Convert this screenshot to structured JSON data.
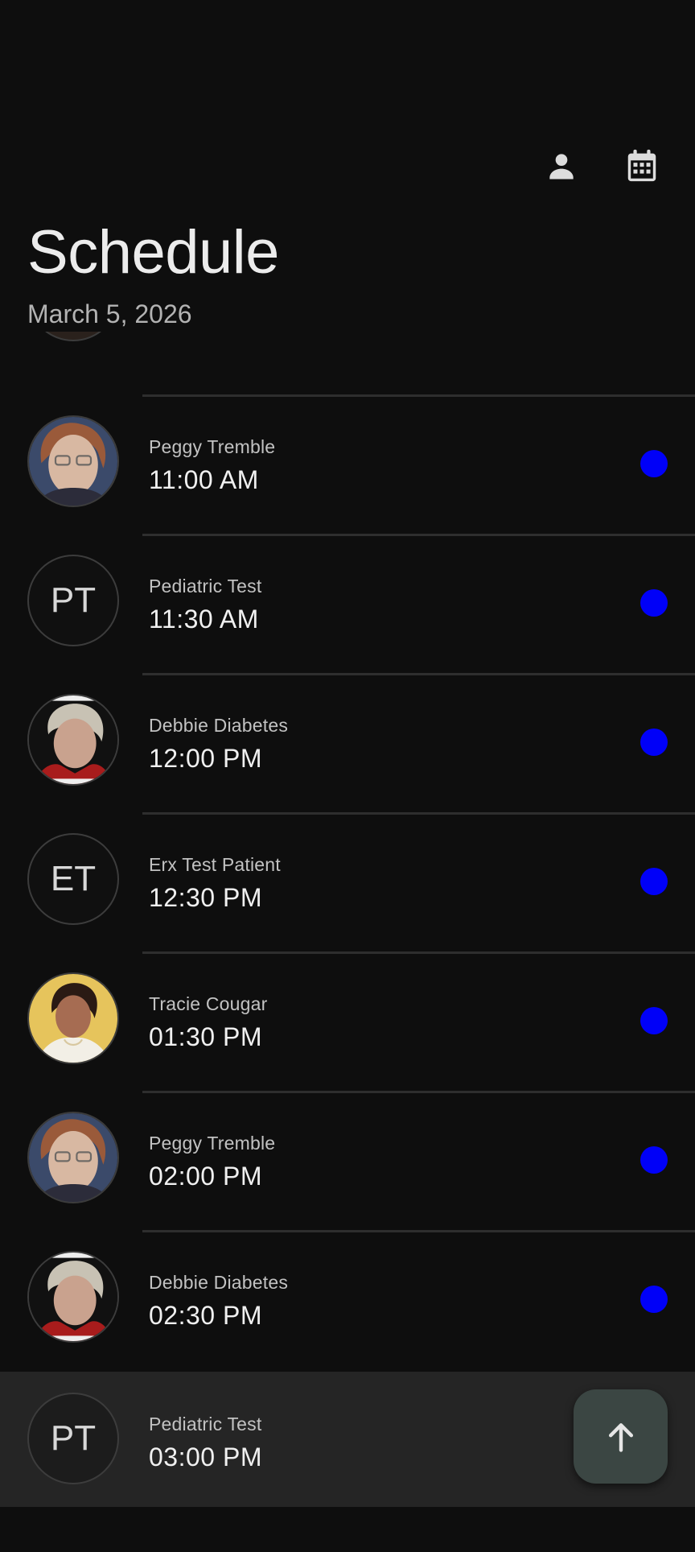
{
  "header": {
    "title": "Schedule",
    "date": "March 5, 2026",
    "actions": [
      {
        "icon": "person-icon"
      },
      {
        "icon": "calendar-icon"
      }
    ]
  },
  "colors": {
    "background": "#0e0e0e",
    "status_dot": "#0000f8",
    "fab": "#3b4643",
    "selected_row": "#252525"
  },
  "appointments": [
    {
      "name": "Peggy Tremble",
      "time": "11:00 AM",
      "avatar": "photo",
      "status": "blue-dot"
    },
    {
      "name": "Pediatric Test",
      "time": "11:30 AM",
      "avatar": "initials",
      "initials": "PT",
      "status": "blue-dot"
    },
    {
      "name": "Debbie Diabetes",
      "time": "12:00 PM",
      "avatar": "photo",
      "status": "blue-dot"
    },
    {
      "name": "Erx Test Patient",
      "time": "12:30 PM",
      "avatar": "initials",
      "initials": "ET",
      "status": "blue-dot"
    },
    {
      "name": "Tracie Cougar",
      "time": "01:30 PM",
      "avatar": "photo",
      "status": "blue-dot"
    },
    {
      "name": "Peggy Tremble",
      "time": "02:00 PM",
      "avatar": "photo",
      "status": "blue-dot"
    },
    {
      "name": "Debbie Diabetes",
      "time": "02:30 PM",
      "avatar": "photo",
      "status": "blue-dot"
    },
    {
      "name": "Pediatric Test",
      "time": "03:00 PM",
      "avatar": "initials",
      "initials": "PT",
      "status": "none"
    }
  ],
  "fab": {
    "icon": "arrow-up-icon"
  }
}
